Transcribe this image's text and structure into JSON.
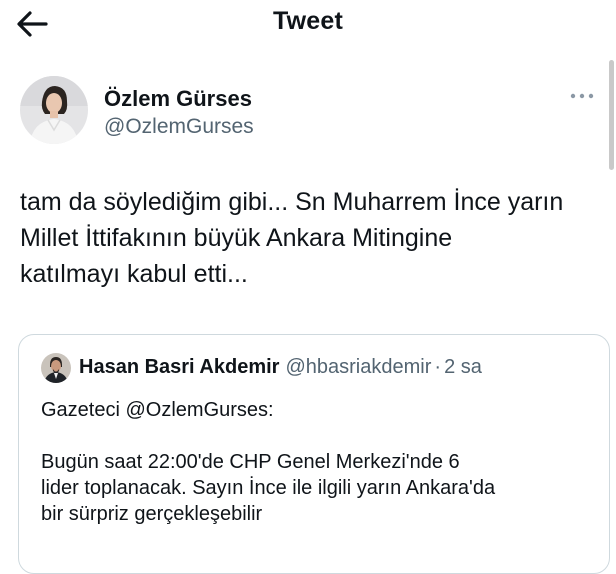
{
  "header": {
    "title": "Tweet",
    "back_icon": "arrow-left-icon"
  },
  "author": {
    "name": "Özlem Gürses",
    "handle": "@OzlemGurses",
    "more_icon": "more-horizontal-icon"
  },
  "tweet": {
    "lines": [
      "tam da söylediğim gibi... Sn Muharrem İnce yarın",
      "Millet İttifakının büyük Ankara Mitingine",
      "katılmayı kabul etti..."
    ]
  },
  "quote": {
    "name": "Hasan Basri Akdemir",
    "handle": "@hbasriakdemir",
    "separator": "·",
    "time": "2 sa",
    "lines": [
      "Gazeteci @OzlemGurses:",
      "",
      "Bugün saat 22:00'de CHP Genel Merkezi'nde 6",
      "lider toplanacak. Sayın İnce ile ilgili yarın Ankara'da",
      "bir sürpriz gerçekleşebilir"
    ]
  },
  "colors": {
    "text": "#0f1419",
    "secondary": "#536471",
    "border": "#cfd9de"
  }
}
